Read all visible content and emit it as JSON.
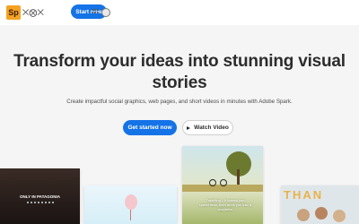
{
  "header": {
    "logo_text": "Sp",
    "brand_text": "⨉⨂⨉",
    "start_button": "Start now",
    "icons": [
      "apps-icon",
      "account-icon"
    ]
  },
  "hero": {
    "headline": "Transform your ideas into stunning visual stories",
    "subtext": "Create impactful social graphics, web pages, and short videos in minutes with Adobe Spark.",
    "cta_primary": "Get started now",
    "cta_secondary": "Watch Video"
  },
  "gallery": {
    "patagonia_caption": "ONLY IN PATAGONIA",
    "bike_quote": "Traveling – it leaves you speechless, then turns you into a storyteller",
    "thanks_text": "THAN"
  },
  "colors": {
    "primary_blue": "#1473e6",
    "brand_orange": "#f4a223",
    "page_bg": "#f5f5f5"
  }
}
